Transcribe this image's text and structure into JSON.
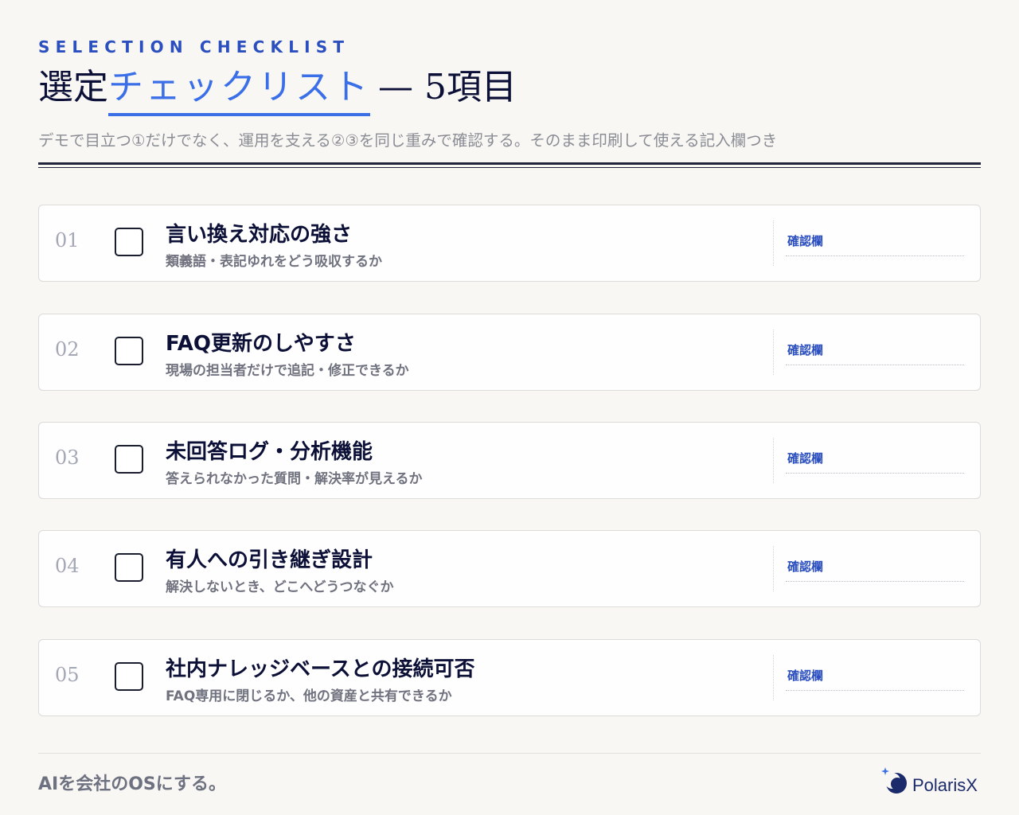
{
  "header": {
    "eyebrow": "SELECTION CHECKLIST",
    "title_main": "選定",
    "title_accent": "チェックリスト",
    "title_rest": "— 5項目",
    "subtitle": "デモで目立つ①だけでなく、運用を支える②③を同じ重みで確認する。そのまま印刷して使える記入欄つき"
  },
  "items": [
    {
      "num": "01",
      "title": "言い換え対応の強さ",
      "desc": "類義語・表記ゆれをどう吸収するか",
      "confirm_label": "確認欄",
      "checked": false
    },
    {
      "num": "02",
      "title": "FAQ更新のしやすさ",
      "desc": "現場の担当者だけで追記・修正できるか",
      "confirm_label": "確認欄",
      "checked": false
    },
    {
      "num": "03",
      "title": "未回答ログ・分析機能",
      "desc": "答えられなかった質問・解決率が見えるか",
      "confirm_label": "確認欄",
      "checked": false
    },
    {
      "num": "04",
      "title": "有人への引き継ぎ設計",
      "desc": "解決しないとき、どこへどうつなぐか",
      "confirm_label": "確認欄",
      "checked": false
    },
    {
      "num": "05",
      "title": "社内ナレッジベースとの接続可否",
      "desc": "FAQ専用に閉じるか、他の資産と共有できるか",
      "confirm_label": "確認欄",
      "checked": false
    }
  ],
  "footer": {
    "tagline": "AIを会社のOSにする。",
    "brand": "PolarisX"
  },
  "colors": {
    "accent": "#3b6fe8",
    "eyebrow": "#2b4fbf",
    "heading": "#0c1037",
    "muted": "#70737f"
  }
}
